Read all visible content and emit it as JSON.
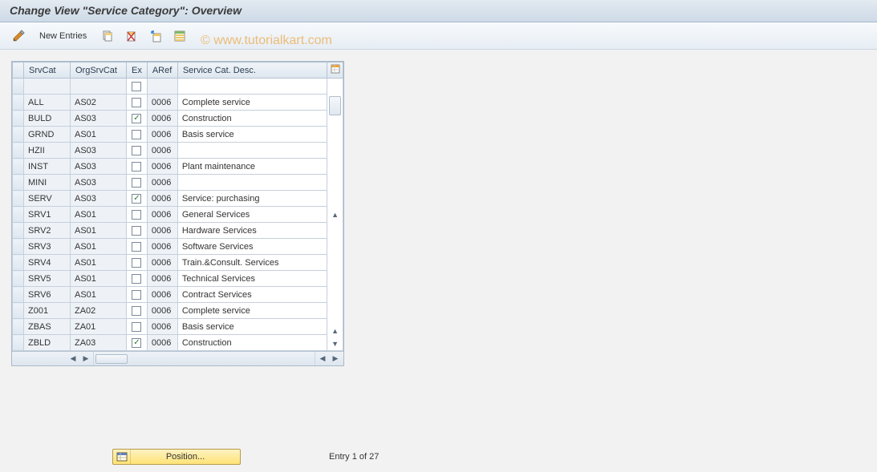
{
  "title": "Change View \"Service Category\": Overview",
  "watermark": "© www.tutorialkart.com",
  "toolbar": {
    "new_entries_label": "New Entries"
  },
  "grid": {
    "columns": {
      "srvcat": "SrvCat",
      "orgsrvcat": "OrgSrvCat",
      "ex": "Ex",
      "aref": "ARef",
      "desc": "Service Cat. Desc."
    },
    "rows": [
      {
        "srvcat": "",
        "org": "",
        "ex": false,
        "aref": "",
        "desc": ""
      },
      {
        "srvcat": "ALL",
        "org": "AS02",
        "ex": false,
        "aref": "0006",
        "desc": "Complete service"
      },
      {
        "srvcat": "BULD",
        "org": "AS03",
        "ex": true,
        "aref": "0006",
        "desc": "Construction"
      },
      {
        "srvcat": "GRND",
        "org": "AS01",
        "ex": false,
        "aref": "0006",
        "desc": "Basis service"
      },
      {
        "srvcat": "HZII",
        "org": "AS03",
        "ex": false,
        "aref": "0006",
        "desc": ""
      },
      {
        "srvcat": "INST",
        "org": "AS03",
        "ex": false,
        "aref": "0006",
        "desc": "Plant maintenance"
      },
      {
        "srvcat": "MINI",
        "org": "AS03",
        "ex": false,
        "aref": "0006",
        "desc": ""
      },
      {
        "srvcat": "SERV",
        "org": "AS03",
        "ex": true,
        "aref": "0006",
        "desc": "Service: purchasing"
      },
      {
        "srvcat": "SRV1",
        "org": "AS01",
        "ex": false,
        "aref": "0006",
        "desc": "General Services"
      },
      {
        "srvcat": "SRV2",
        "org": "AS01",
        "ex": false,
        "aref": "0006",
        "desc": "Hardware Services"
      },
      {
        "srvcat": "SRV3",
        "org": "AS01",
        "ex": false,
        "aref": "0006",
        "desc": "Software Services"
      },
      {
        "srvcat": "SRV4",
        "org": "AS01",
        "ex": false,
        "aref": "0006",
        "desc": "Train.&Consult. Services"
      },
      {
        "srvcat": "SRV5",
        "org": "AS01",
        "ex": false,
        "aref": "0006",
        "desc": "Technical Services"
      },
      {
        "srvcat": "SRV6",
        "org": "AS01",
        "ex": false,
        "aref": "0006",
        "desc": "Contract Services"
      },
      {
        "srvcat": "Z001",
        "org": "ZA02",
        "ex": false,
        "aref": "0006",
        "desc": "Complete service"
      },
      {
        "srvcat": "ZBAS",
        "org": "ZA01",
        "ex": false,
        "aref": "0006",
        "desc": "Basis service"
      },
      {
        "srvcat": "ZBLD",
        "org": "ZA03",
        "ex": true,
        "aref": "0006",
        "desc": "Construction"
      }
    ]
  },
  "footer": {
    "position_label": "Position...",
    "entry_text": "Entry 1 of 27"
  }
}
